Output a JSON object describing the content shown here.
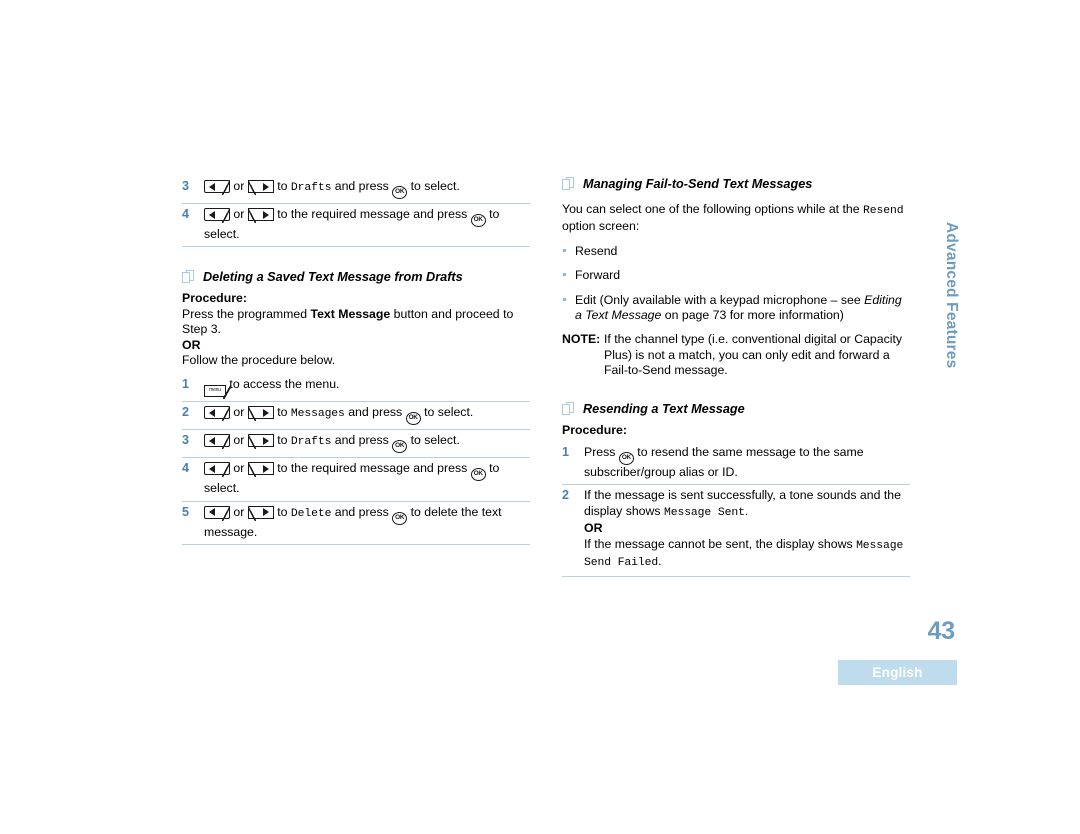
{
  "document": {
    "page_number": "43",
    "language_tab": "English",
    "chapter_title": "Advanced Features"
  },
  "left_column": {
    "top_steps": [
      {
        "number": "3",
        "text_before": "or",
        "text_mid": "to",
        "mono_term": "Drafts",
        "text_after": "and press",
        "text_end": "to select."
      },
      {
        "number": "4",
        "text_before": "or",
        "text_mid": "to the required message and press",
        "text_end": "to select."
      }
    ],
    "section": {
      "heading": "Deleting a Saved Text Message from Drafts",
      "procedure_label": "Procedure:",
      "intro_part1": "Press the programmed",
      "intro_bold": "Text Message",
      "intro_part2": "button and proceed to Step 3.",
      "or_label": "OR",
      "follow_text": "Follow the procedure below."
    },
    "steps": [
      {
        "number": "1",
        "icon": "menu-key-icon",
        "text_end": "to access the menu."
      },
      {
        "number": "2",
        "text_before": "or",
        "text_mid": "to",
        "mono_term": "Messages",
        "text_after": "and press",
        "text_end": "to select."
      },
      {
        "number": "3",
        "text_before": "or",
        "text_mid": "to",
        "mono_term": "Drafts",
        "text_after": "and press",
        "text_end": "to select."
      },
      {
        "number": "4",
        "text_before": "or",
        "text_mid": "to the required message and press",
        "text_end": "to select."
      },
      {
        "number": "5",
        "text_before": "or",
        "text_mid": "to",
        "mono_term": "Delete",
        "text_after": "and press",
        "text_end": "to delete the text message."
      }
    ]
  },
  "right_column": {
    "section1": {
      "heading": "Managing Fail-to-Send Text Messages",
      "intro_part1": "You can select one of the following options while at the",
      "intro_mono": "Resend",
      "intro_part2": "option screen:",
      "bullets": [
        {
          "text": "Resend"
        },
        {
          "text": "Forward"
        },
        {
          "text_part1": "Edit (Only available with a keypad microphone – see",
          "italic_part": "Editing a Text Message",
          "text_part2": "on page 73 for more information)"
        }
      ],
      "note_label": "NOTE:",
      "note_text": "If the channel type (i.e. conventional digital or Capacity Plus) is not a match, you can only edit and forward a Fail-to-Send message."
    },
    "section2": {
      "heading": "Resending a Text Message",
      "procedure_label": "Procedure:",
      "steps": [
        {
          "number": "1",
          "text_before": "Press",
          "text_end": "to resend the same message to the same subscriber/group alias or ID."
        },
        {
          "number": "2",
          "text_line1": "If the message is sent successfully, a tone sounds and the display shows",
          "mono1": "Message Sent",
          "period1": ".",
          "or_label": "OR",
          "text_line2": "If the message cannot be sent, the display shows",
          "mono2": "Message Send Failed",
          "period2": "."
        }
      ]
    }
  },
  "icons": {
    "left_key": "left-arrow-key-icon",
    "right_key": "right-arrow-key-icon",
    "ok_key": "ok-key-icon",
    "menu_key": "menu-key-icon",
    "pages": "stacked-pages-icon",
    "ok_label": "OK",
    "menu_label": "menu"
  }
}
